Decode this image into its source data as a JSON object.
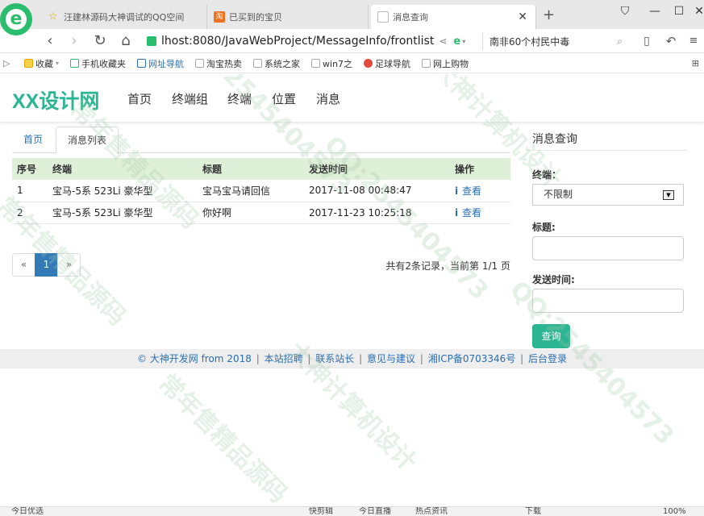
{
  "browser": {
    "tabs": [
      {
        "title": "汪建林源码大神调试的QQ空间",
        "active": false
      },
      {
        "title": "已买到的宝贝",
        "active": false
      },
      {
        "title": "消息查询",
        "active": true
      }
    ],
    "new_tab": "+",
    "address": "lhost:8080/JavaWebProject/MessageInfo/frontlist",
    "search_text": "南非60个村民中毒",
    "bookmarks": [
      "收藏",
      "手机收藏夹",
      "网址导航",
      "淘宝热卖",
      "系统之家",
      "win7之",
      "足球导航",
      "网上购物"
    ]
  },
  "site": {
    "brand": "XX设计网",
    "nav": [
      "首页",
      "终端组",
      "终端",
      "位置",
      "消息"
    ]
  },
  "content": {
    "tabs": {
      "home": "首页",
      "active": "消息列表"
    },
    "table": {
      "headers": [
        "序号",
        "终端",
        "标题",
        "发送时间",
        "操作"
      ],
      "rows": [
        {
          "no": "1",
          "terminal": "宝马-5系 523Li 豪华型",
          "title": "宝马宝马请回信",
          "time": "2017-11-08 00:48:47",
          "action": "查看"
        },
        {
          "no": "2",
          "terminal": "宝马-5系 523Li 豪华型",
          "title": "你好啊",
          "time": "2017-11-23 10:25:18",
          "action": "查看"
        }
      ]
    },
    "pager": {
      "prev": "«",
      "current": "1",
      "next": "»"
    },
    "record_info": "共有2条记录，当前第 1/1 页"
  },
  "sidebar": {
    "title": "消息查询",
    "terminal_label": "终端：",
    "terminal_value": "不限制",
    "title_label": "标题:",
    "time_label": "发送时间:",
    "query_button": "查询"
  },
  "footer": {
    "copyright": "© 大神开发网 from 2018",
    "links": [
      "本站招聘",
      "联系站长",
      "意见与建议",
      "湘ICP备0703346号",
      "后台登录"
    ]
  },
  "statusbar": {
    "left": "今日优选",
    "items": [
      "快剪辑",
      "今日直播",
      "热点资讯",
      "下载",
      "100%"
    ]
  },
  "watermark": {
    "lines": [
      "QQ:2545404573",
      "常年售精品源码",
      "大神计算机设计",
      "QQ:2545404573",
      "常年售精品源码",
      "大神计算机设计",
      "QQ:2545404573",
      "常年售精品源码"
    ]
  },
  "colors": {
    "brand": "#2bb592",
    "link": "#2a6fb0",
    "table_header": "#dff0d8",
    "pager_active": "#337ab7"
  }
}
